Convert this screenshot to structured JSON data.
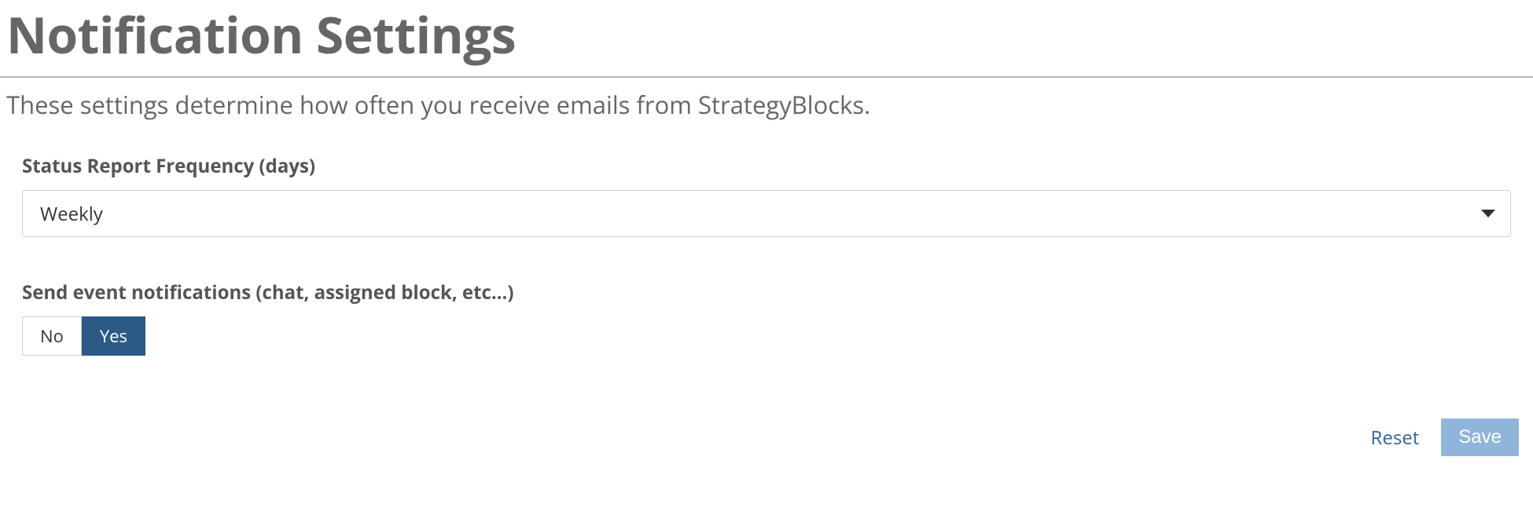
{
  "title": "Notification Settings",
  "description": "These settings determine how often you receive emails from StrategyBlocks.",
  "fields": {
    "frequency": {
      "label": "Status Report Frequency (days)",
      "value": "Weekly"
    },
    "event_notifications": {
      "label": "Send event notifications (chat, assigned block, etc...)",
      "no_label": "No",
      "yes_label": "Yes",
      "value": "Yes"
    }
  },
  "actions": {
    "reset": "Reset",
    "save": "Save"
  }
}
